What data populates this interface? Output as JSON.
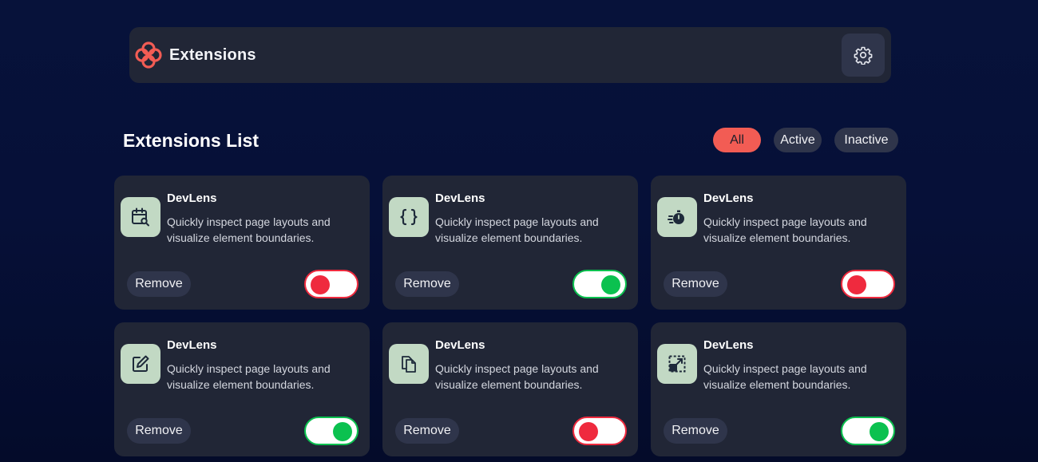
{
  "header": {
    "brand_name": "Extensions",
    "logo_icon": "flower-logo-icon",
    "settings_icon": "gear-icon"
  },
  "list": {
    "title": "Extensions List",
    "filters": [
      "All",
      "Active",
      "Inactive"
    ],
    "selected_filter": "All"
  },
  "colors": {
    "accent": "#f25c54",
    "toggle_on": "#0bc14f",
    "toggle_off": "#ef2a3e",
    "card_bg": "#212636",
    "icon_bg": "#c2d9c4"
  },
  "extensions": [
    {
      "name": "DevLens",
      "description": "Quickly inspect page layouts and visualize element boundaries.",
      "icon": "calendar-search-icon",
      "remove_label": "Remove",
      "enabled": false
    },
    {
      "name": "DevLens",
      "description": "Quickly inspect page layouts and visualize element boundaries.",
      "icon": "braces-icon",
      "remove_label": "Remove",
      "enabled": true
    },
    {
      "name": "DevLens",
      "description": "Quickly inspect page layouts and visualize element boundaries.",
      "icon": "stopwatch-icon",
      "remove_label": "Remove",
      "enabled": false
    },
    {
      "name": "DevLens",
      "description": "Quickly inspect page layouts and visualize element boundaries.",
      "icon": "edit-note-icon",
      "remove_label": "Remove",
      "enabled": true
    },
    {
      "name": "DevLens",
      "description": "Quickly inspect page layouts and visualize element boundaries.",
      "icon": "documents-icon",
      "remove_label": "Remove",
      "enabled": false
    },
    {
      "name": "DevLens",
      "description": "Quickly inspect page layouts and visualize element boundaries.",
      "icon": "resize-arrow-icon",
      "remove_label": "Remove",
      "enabled": true
    }
  ]
}
